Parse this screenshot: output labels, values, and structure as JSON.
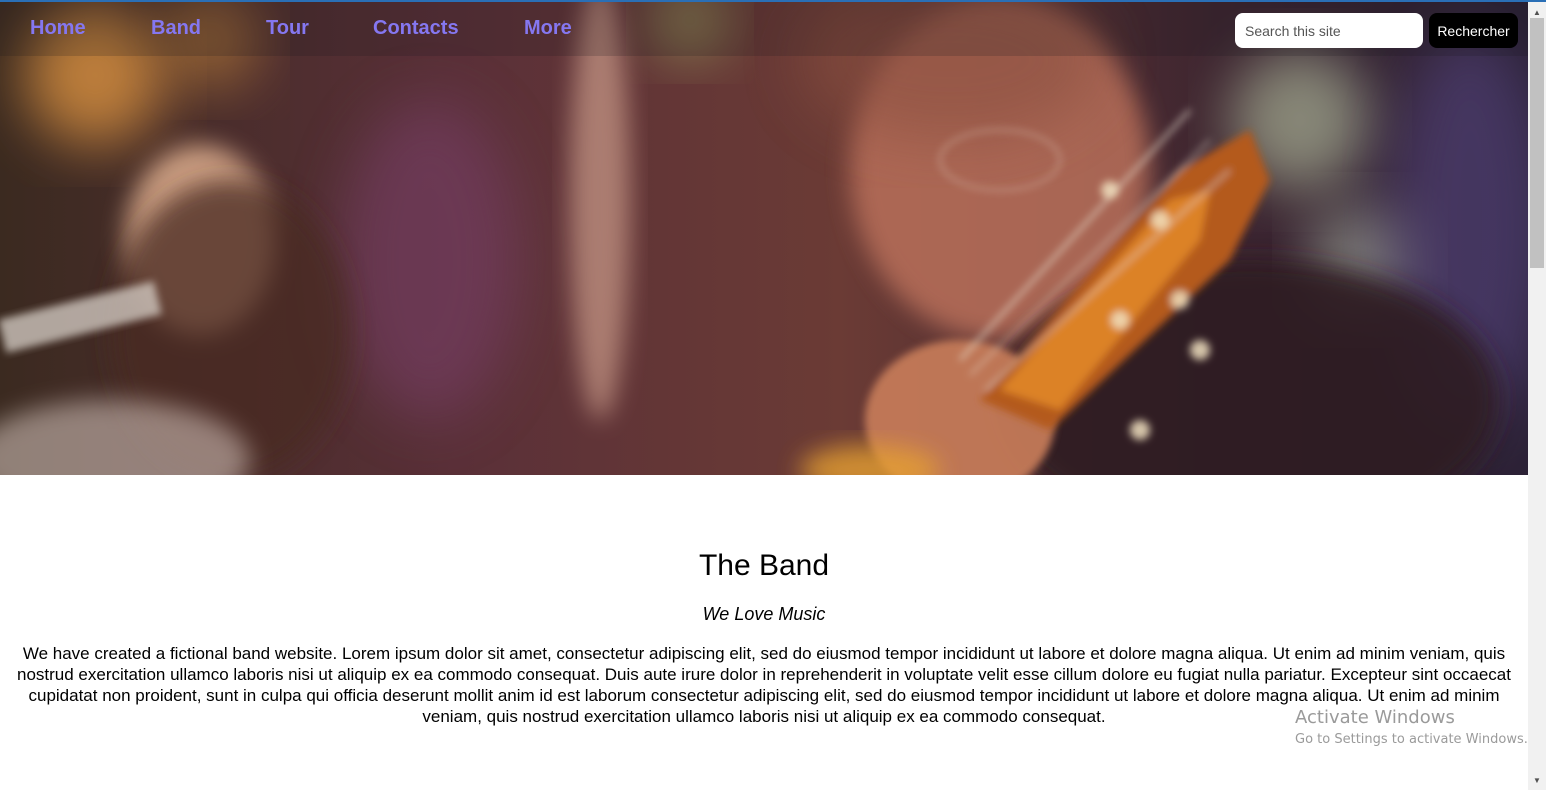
{
  "nav": {
    "items": [
      {
        "label": "Home"
      },
      {
        "label": "Band"
      },
      {
        "label": "Tour"
      },
      {
        "label": "Contacts"
      },
      {
        "label": "More"
      }
    ],
    "link_color": "#8577f0"
  },
  "search": {
    "placeholder": "Search this site",
    "button_label": "Rechercher"
  },
  "hero": {
    "image": "blurred photo of a band performing, guitarist playing an acoustic guitar in the foreground and singer at a microphone behind"
  },
  "band": {
    "title": "The Band",
    "subtitle": "We Love Music",
    "text": "We have created a fictional band website. Lorem ipsum dolor sit amet, consectetur adipiscing elit, sed do eiusmod tempor incididunt ut labore et dolore magna aliqua. Ut enim ad minim veniam, quis nostrud exercitation ullamco laboris nisi ut aliquip ex ea commodo consequat. Duis aute irure dolor in reprehenderit in voluptate velit esse cillum dolore eu fugiat nulla pariatur. Excepteur sint occaecat cupidatat non proident, sunt in culpa qui officia deserunt mollit anim id est laborum consectetur adipiscing elit, sed do eiusmod tempor incididunt ut labore et dolore magna aliqua. Ut enim ad minim veniam, quis nostrud exercitation ullamco laboris nisi ut aliquip ex ea commodo consequat."
  },
  "watermark": {
    "title": "Activate Windows",
    "subtitle": "Go to Settings to activate Windows."
  },
  "scrollbar": {
    "up_icon": "triangle-up-icon",
    "down_icon": "triangle-down-icon"
  }
}
